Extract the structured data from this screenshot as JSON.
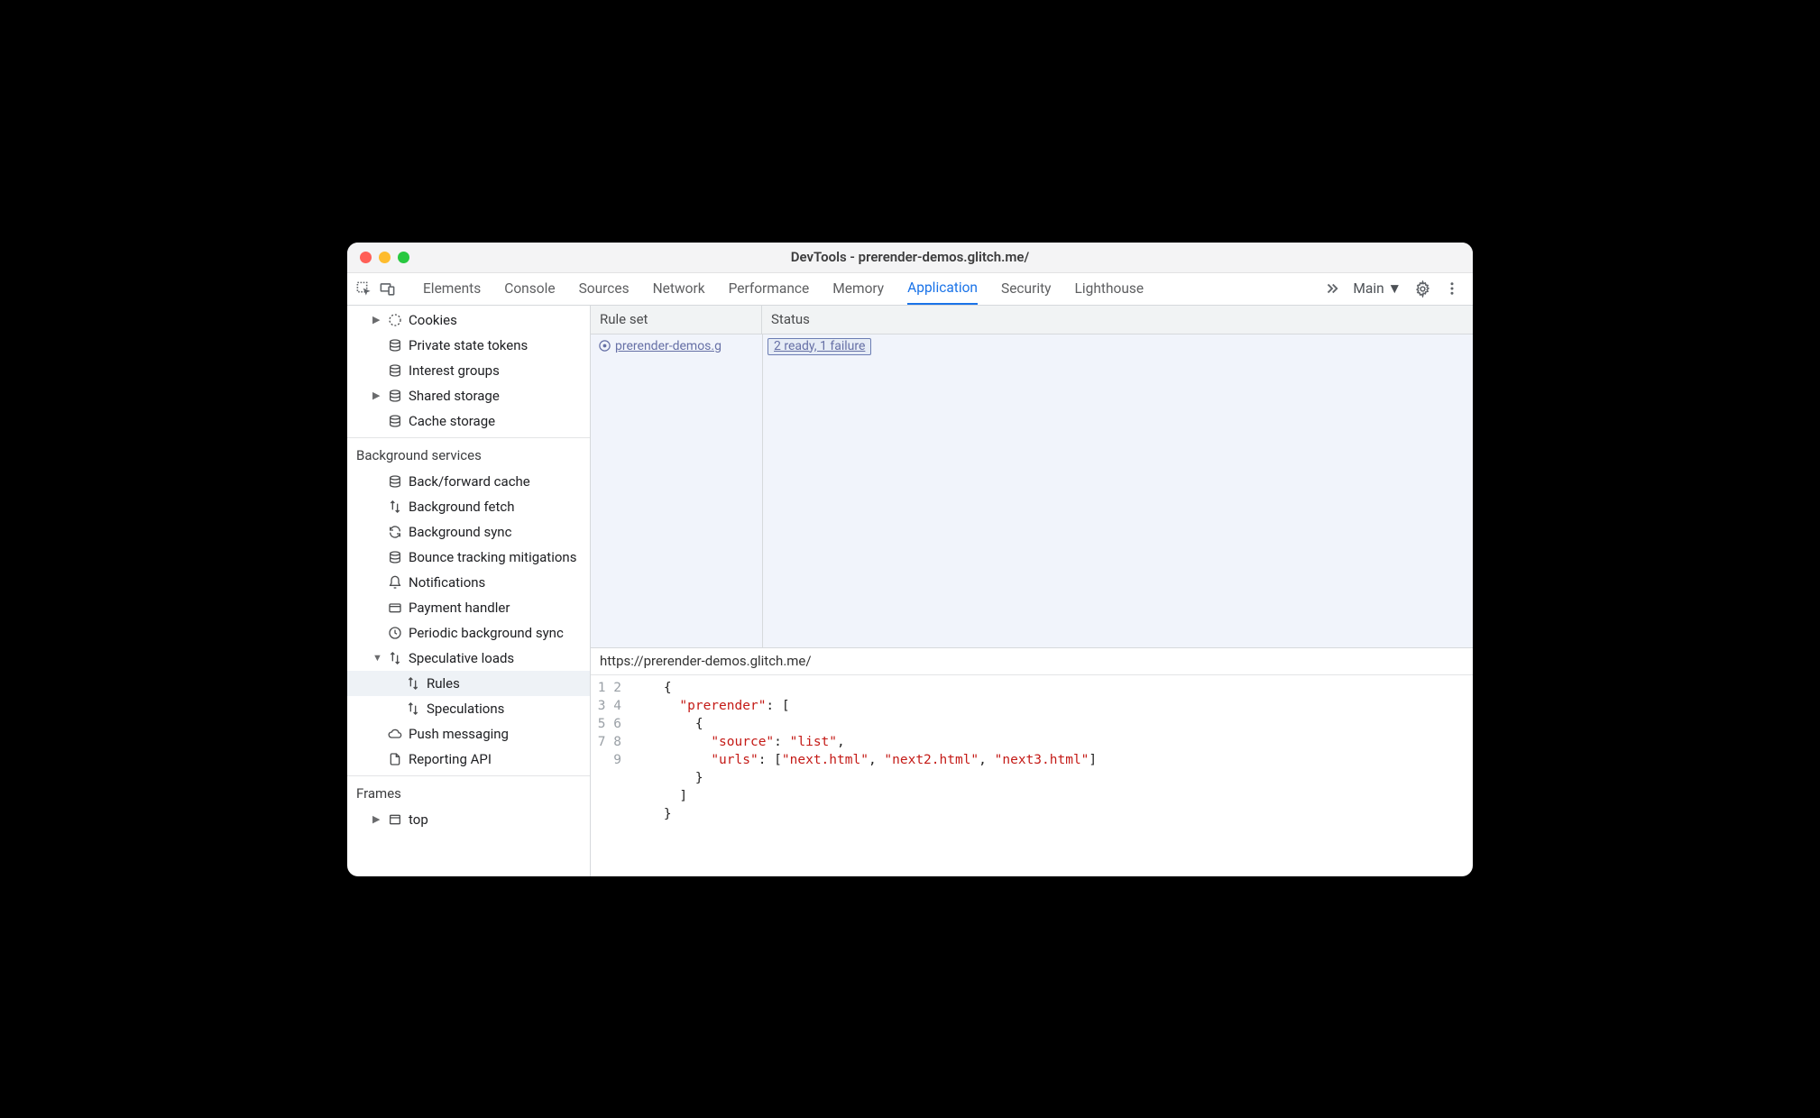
{
  "window": {
    "title": "DevTools - prerender-demos.glitch.me/"
  },
  "tabs": {
    "items": [
      "Elements",
      "Console",
      "Sources",
      "Network",
      "Performance",
      "Memory",
      "Application",
      "Security",
      "Lighthouse"
    ],
    "active": "Application",
    "context": "Main"
  },
  "sidebar": {
    "storage": [
      {
        "label": "Cookies",
        "icon": "cookie",
        "arrow": "right"
      },
      {
        "label": "Private state tokens",
        "icon": "db"
      },
      {
        "label": "Interest groups",
        "icon": "db"
      },
      {
        "label": "Shared storage",
        "icon": "db",
        "arrow": "right"
      },
      {
        "label": "Cache storage",
        "icon": "db"
      }
    ],
    "section_bg": "Background services",
    "bg": [
      {
        "label": "Back/forward cache",
        "icon": "db"
      },
      {
        "label": "Background fetch",
        "icon": "updown"
      },
      {
        "label": "Background sync",
        "icon": "sync"
      },
      {
        "label": "Bounce tracking mitigations",
        "icon": "db"
      },
      {
        "label": "Notifications",
        "icon": "bell"
      },
      {
        "label": "Payment handler",
        "icon": "card"
      },
      {
        "label": "Periodic background sync",
        "icon": "clock"
      },
      {
        "label": "Speculative loads",
        "icon": "updown",
        "arrow": "down"
      },
      {
        "label": "Rules",
        "icon": "updown",
        "indent": 2,
        "selected": true
      },
      {
        "label": "Speculations",
        "icon": "updown",
        "indent": 2
      },
      {
        "label": "Push messaging",
        "icon": "cloud"
      },
      {
        "label": "Reporting API",
        "icon": "file"
      }
    ],
    "section_frames": "Frames",
    "frames": [
      {
        "label": "top",
        "icon": "frame",
        "arrow": "right"
      }
    ]
  },
  "grid": {
    "col1": "Rule set",
    "col2": "Status",
    "row": {
      "ruleset": "prerender-demos.g",
      "status": "2 ready, 1 failure"
    }
  },
  "detail": {
    "url": "https://prerender-demos.glitch.me/",
    "code_html": "<span class='tok-p'>{</span>\n  <span class='tok-key'>\"prerender\"</span><span class='tok-p'>: [</span>\n    <span class='tok-p'>{</span>\n      <span class='tok-key'>\"source\"</span><span class='tok-p'>: </span><span class='tok-str'>\"list\"</span><span class='tok-p'>,</span>\n      <span class='tok-key'>\"urls\"</span><span class='tok-p'>: [</span><span class='tok-str'>\"next.html\"</span><span class='tok-p'>, </span><span class='tok-str'>\"next2.html\"</span><span class='tok-p'>, </span><span class='tok-str'>\"next3.html\"</span><span class='tok-p'>]</span>\n    <span class='tok-p'>}</span>\n  <span class='tok-p'>]</span>\n<span class='tok-p'>}</span>",
    "line_count": 9
  }
}
